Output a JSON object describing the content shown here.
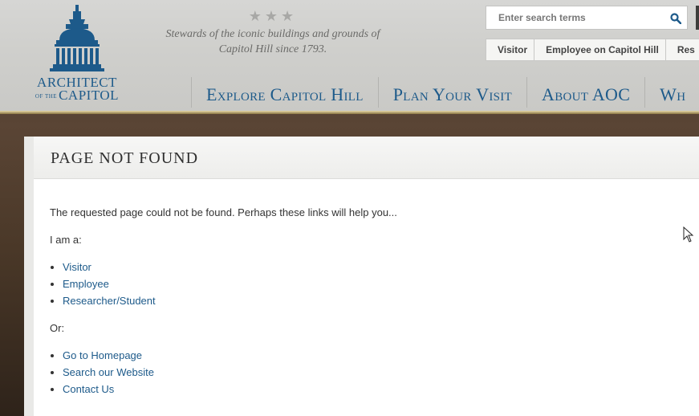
{
  "header": {
    "logo": {
      "line1": "ARCHITECT",
      "line2_prefix": "OF THE",
      "line2_main": "CAPITOL"
    },
    "stars": "★★★",
    "tagline": "Stewards of the iconic buildings and grounds of Capitol Hill since 1793.",
    "search": {
      "placeholder": "Enter search terms"
    },
    "audience_links": [
      "Visitor",
      "Employee on Capitol Hill",
      "Res"
    ],
    "nav": [
      "Explore Capitol Hill",
      "Plan Your Visit",
      "About AOC",
      "Wh"
    ]
  },
  "main": {
    "title": "PAGE NOT FOUND",
    "intro": "The requested page could not be found.  Perhaps these links will help you...",
    "i_am_label": "I am a:",
    "role_links": [
      "Visitor",
      "Employee",
      "Researcher/Student"
    ],
    "or_label": "Or:",
    "other_links": [
      "Go to Homepage",
      "Search our Website",
      "Contact Us"
    ]
  },
  "colors": {
    "brand_blue": "#1d5a8a",
    "gold": "#b9a77a"
  }
}
